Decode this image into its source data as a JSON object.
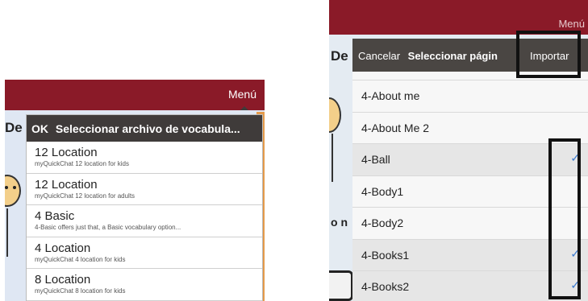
{
  "left_panel": {
    "menu_label": "Menú",
    "background_text": "De",
    "popover": {
      "ok_label": "OK",
      "title": "Seleccionar archivo de vocabula...",
      "items": [
        {
          "title": "12 Location",
          "subtitle": "myQuickChat 12 location for kids"
        },
        {
          "title": "12 Location",
          "subtitle": "myQuickChat 12 location for adults"
        },
        {
          "title": "4 Basic",
          "subtitle": "4-Basic offers just that, a Basic vocabulary option..."
        },
        {
          "title": "4 Location",
          "subtitle": "myQuickChat 4 location for kids"
        },
        {
          "title": "8 Location",
          "subtitle": "myQuickChat 8 location for kids"
        }
      ]
    }
  },
  "right_panel": {
    "menu_label": "Menú",
    "background_text": "De",
    "background_text_2": "o n",
    "popover": {
      "cancel_label": "Cancelar",
      "title": "Seleccionar págin",
      "import_label": "Importar",
      "items": [
        {
          "label": "4-About me",
          "checked": false
        },
        {
          "label": "4-About Me 2",
          "checked": false
        },
        {
          "label": "4-Ball",
          "checked": true
        },
        {
          "label": "4-Body1",
          "checked": false
        },
        {
          "label": "4-Body2",
          "checked": false
        },
        {
          "label": "4-Books1",
          "checked": true
        },
        {
          "label": "4-Books2",
          "checked": true
        }
      ],
      "check_glyph": "✓"
    }
  },
  "colors": {
    "header_red": "#8a1a28",
    "popover_header": "#3f3b3a",
    "check_blue": "#3c7bd0",
    "accent_orange": "#e59a46"
  }
}
